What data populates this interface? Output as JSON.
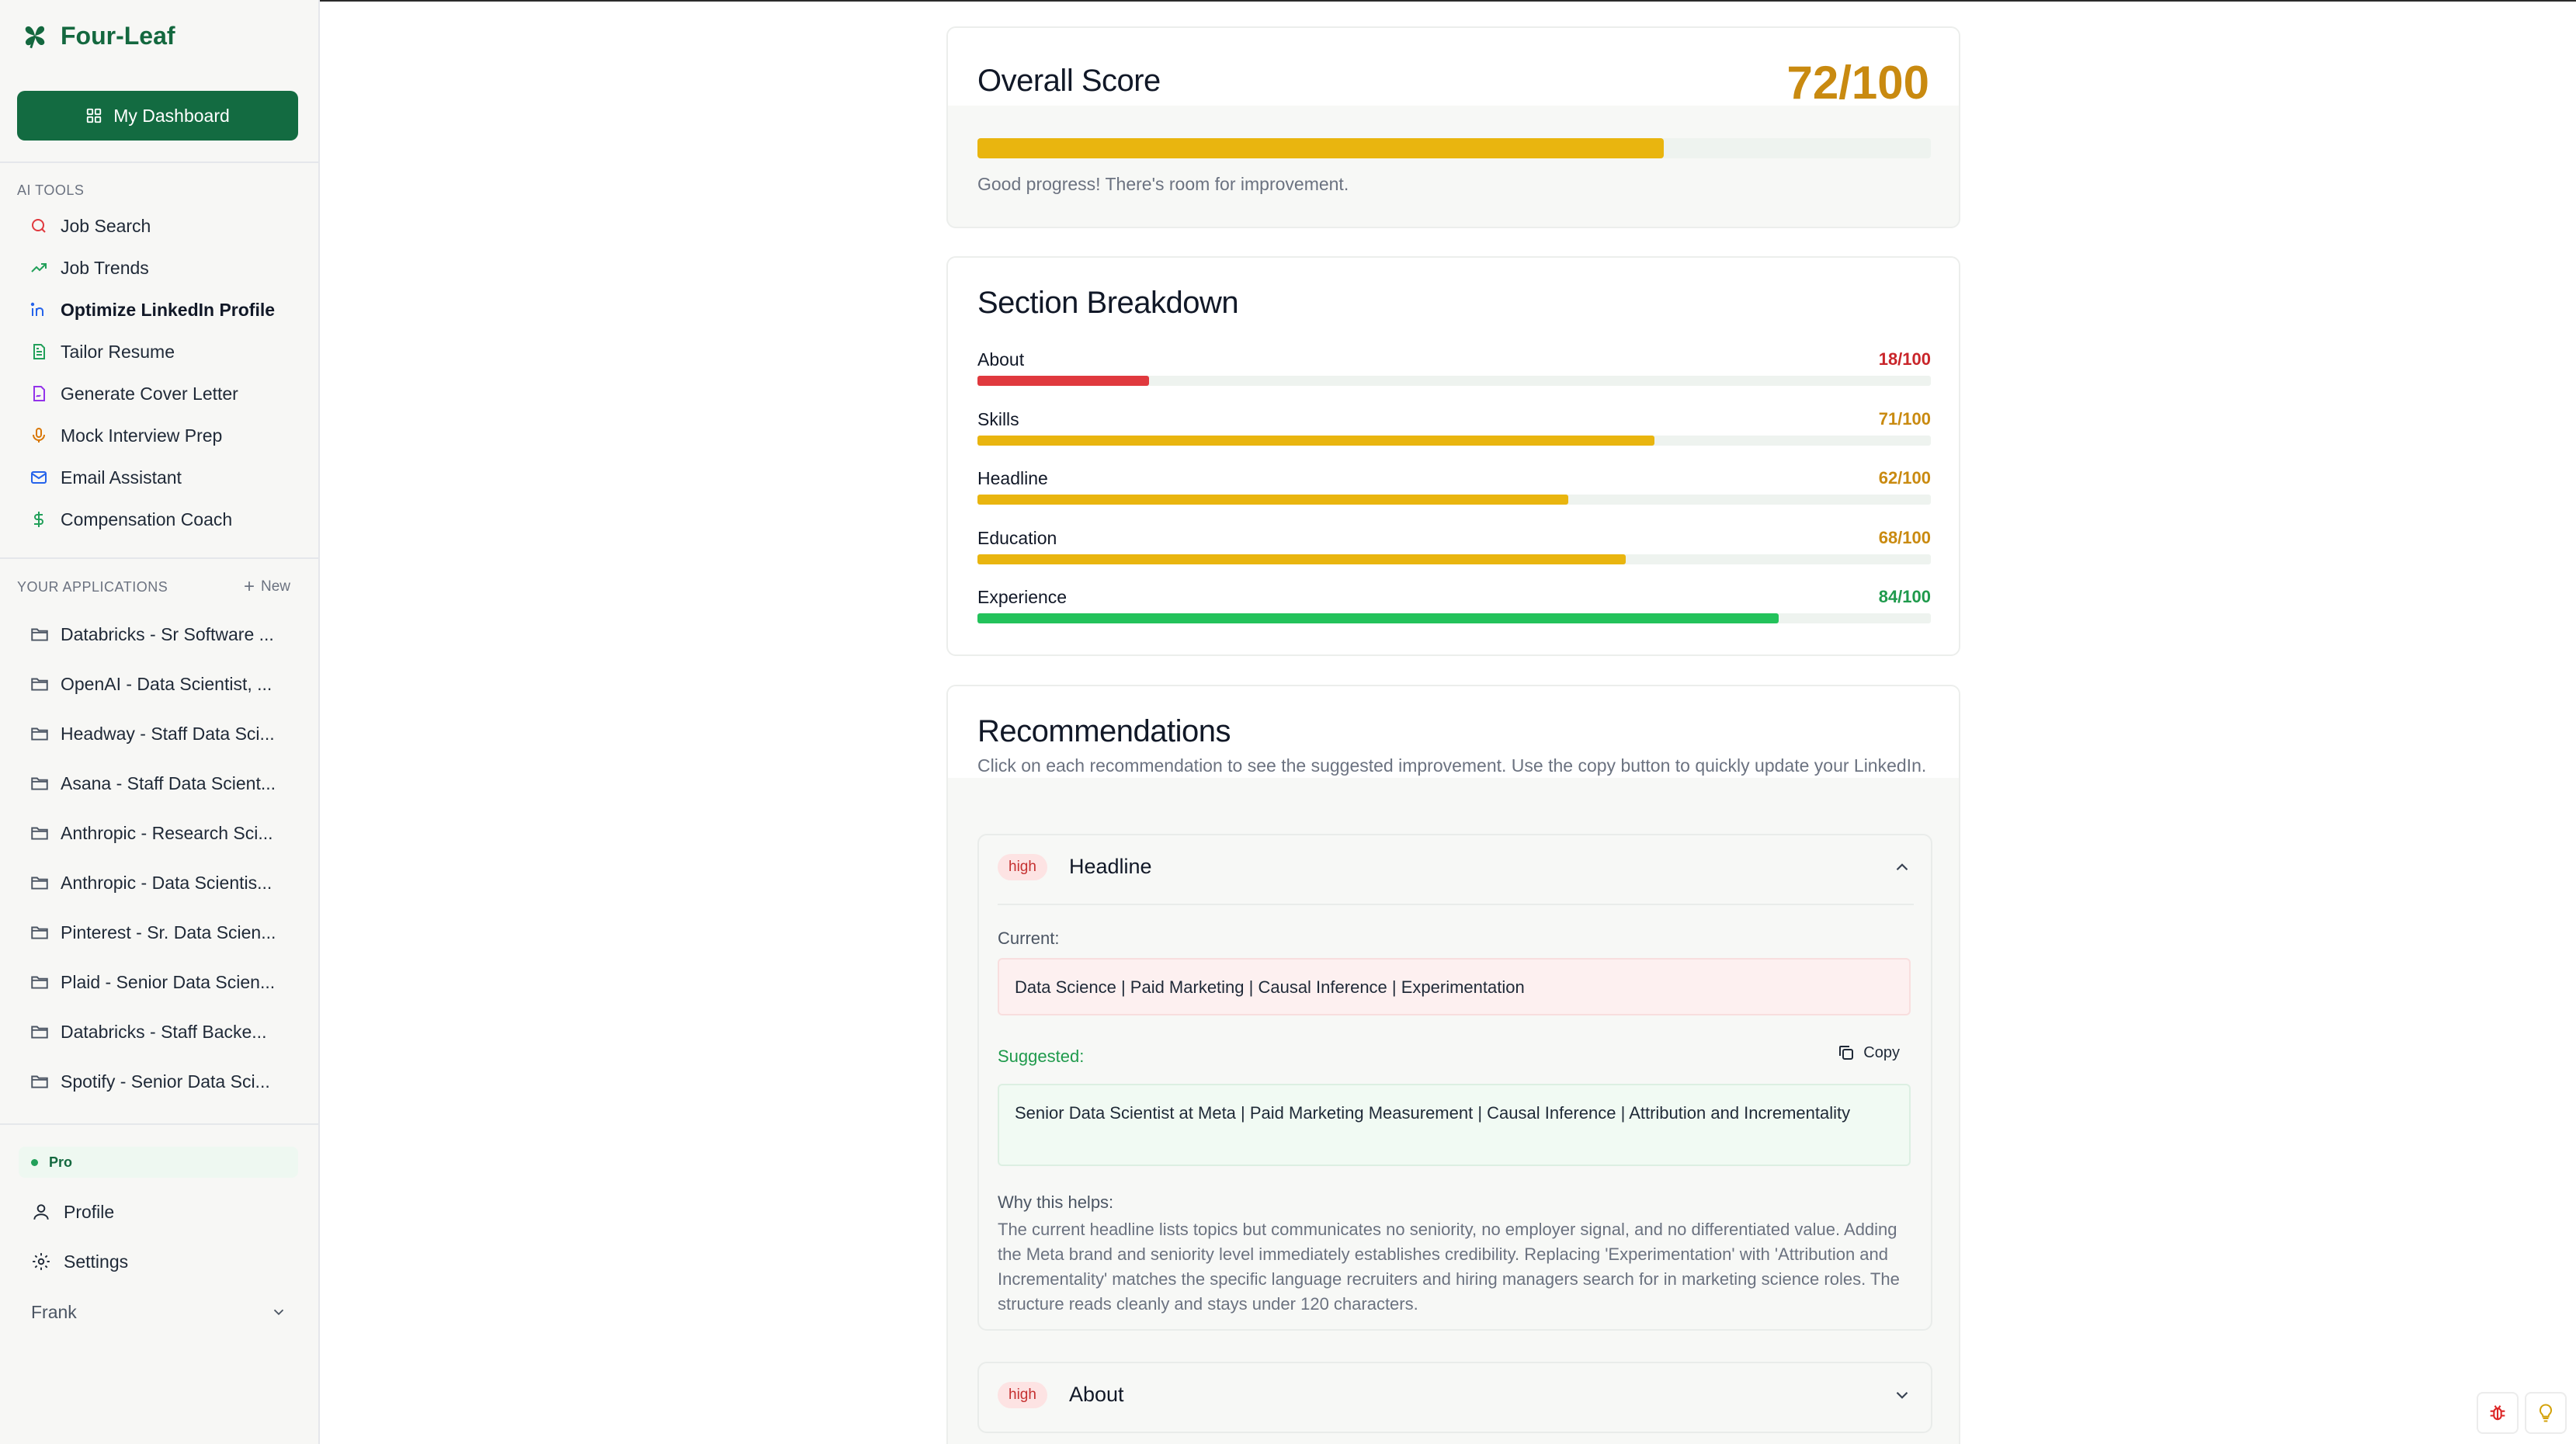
{
  "app": {
    "name": "Four-Leaf"
  },
  "sidebar": {
    "dashboard_label": "My Dashboard",
    "ai_tools_label": "AI TOOLS",
    "ai_tools": [
      {
        "label": "Job Search",
        "icon": "search-icon"
      },
      {
        "label": "Job Trends",
        "icon": "trend-up-icon"
      },
      {
        "label": "Optimize LinkedIn Profile",
        "icon": "linkedin-icon",
        "active": true
      },
      {
        "label": "Tailor Resume",
        "icon": "document-icon"
      },
      {
        "label": "Generate Cover Letter",
        "icon": "signature-file-icon"
      },
      {
        "label": "Mock Interview Prep",
        "icon": "microphone-icon"
      },
      {
        "label": "Email Assistant",
        "icon": "mail-icon"
      },
      {
        "label": "Compensation Coach",
        "icon": "dollar-icon"
      }
    ],
    "applications_label": "YOUR APPLICATIONS",
    "new_label": "New",
    "applications": [
      "Databricks - Sr Software ...",
      "OpenAI - Data Scientist, ...",
      "Headway - Staff Data Sci...",
      "Asana - Staff Data Scient...",
      "Anthropic - Research Sci...",
      "Anthropic - Data Scientis...",
      "Pinterest - Sr. Data Scien...",
      "Plaid - Senior Data Scien...",
      "Databricks - Staff Backe...",
      "Spotify - Senior Data Sci..."
    ],
    "plan_badge": "Pro",
    "profile_label": "Profile",
    "settings_label": "Settings",
    "user_name": "Frank"
  },
  "overall": {
    "title": "Overall Score",
    "score_text": "72/100",
    "score": 72,
    "message": "Good progress! There's room for improvement.",
    "bar_color": "#e9b50f"
  },
  "breakdown": {
    "title": "Section Breakdown",
    "sections": [
      {
        "name": "About",
        "score_text": "18/100",
        "score": 18,
        "color": "#e0393e",
        "text_color": "#c9252a"
      },
      {
        "name": "Skills",
        "score_text": "71/100",
        "score": 71,
        "color": "#e9b50f",
        "text_color": "#c98a10"
      },
      {
        "name": "Headline",
        "score_text": "62/100",
        "score": 62,
        "color": "#e9b50f",
        "text_color": "#c98a10"
      },
      {
        "name": "Education",
        "score_text": "68/100",
        "score": 68,
        "color": "#e9b50f",
        "text_color": "#c98a10"
      },
      {
        "name": "Experience",
        "score_text": "84/100",
        "score": 84,
        "color": "#23c25b",
        "text_color": "#1f9a4c"
      }
    ]
  },
  "recommendations": {
    "title": "Recommendations",
    "subtitle": "Click on each recommendation to see the suggested improvement. Use the copy button to quickly update your LinkedIn.",
    "items": [
      {
        "priority": "high",
        "title": "Headline",
        "expanded": true,
        "current_label": "Current:",
        "current": "Data Science | Paid Marketing | Causal Inference | Experimentation",
        "suggested_label": "Suggested:",
        "copy_label": "Copy",
        "suggested": "Senior Data Scientist at Meta | Paid Marketing Measurement | Causal Inference | Attribution and Incrementality",
        "why_label": "Why this helps:",
        "why": "The current headline lists topics but communicates no seniority, no employer signal, and no differentiated value. Adding the Meta brand and seniority level immediately establishes credibility. Replacing 'Experimentation' with 'Attribution and Incrementality' matches the specific language recruiters and hiring managers search for in marketing science roles. The structure reads cleanly and stays under 120 characters."
      },
      {
        "priority": "high",
        "title": "About",
        "expanded": false
      }
    ]
  },
  "colors": {
    "brand": "#136b41",
    "current_bg": "#fdf0f0",
    "suggested_bg": "#f1faf3",
    "suggested_label": "#1f9a4c"
  }
}
